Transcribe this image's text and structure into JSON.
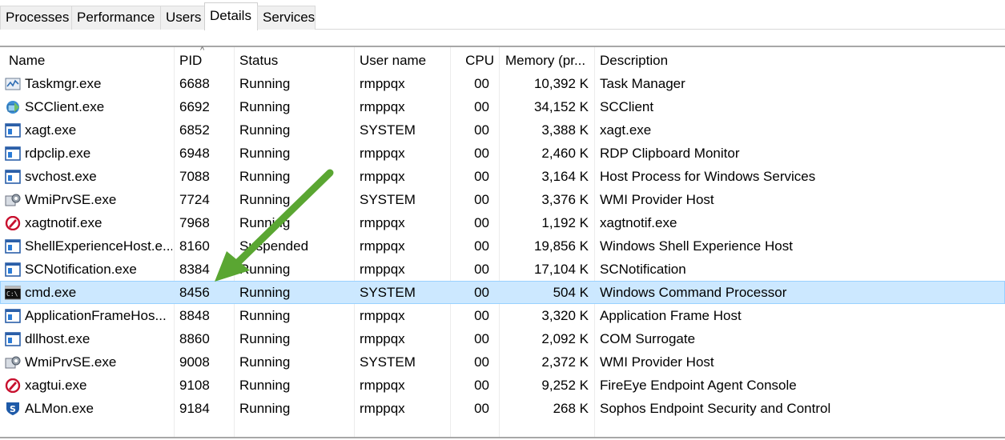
{
  "tabs": [
    {
      "label": "Processes",
      "active": false
    },
    {
      "label": "Performance",
      "active": false
    },
    {
      "label": "Users",
      "active": false
    },
    {
      "label": "Details",
      "active": true
    },
    {
      "label": "Services",
      "active": false
    }
  ],
  "columns": {
    "name": "Name",
    "pid": "PID",
    "status": "Status",
    "user": "User name",
    "cpu": "CPU",
    "memory": "Memory (pr...",
    "description": "Description"
  },
  "rows": [
    {
      "icon": "task-manager-icon",
      "name": "Taskmgr.exe",
      "pid": "6688",
      "status": "Running",
      "user": "rmppqx",
      "cpu": "00",
      "memory": "10,392 K",
      "description": "Task Manager",
      "selected": false
    },
    {
      "icon": "scclient-icon",
      "name": "SCClient.exe",
      "pid": "6692",
      "status": "Running",
      "user": "rmppqx",
      "cpu": "00",
      "memory": "34,152 K",
      "description": "SCClient",
      "selected": false
    },
    {
      "icon": "window-app-icon",
      "name": "xagt.exe",
      "pid": "6852",
      "status": "Running",
      "user": "SYSTEM",
      "cpu": "00",
      "memory": "3,388 K",
      "description": "xagt.exe",
      "selected": false
    },
    {
      "icon": "window-app-icon",
      "name": "rdpclip.exe",
      "pid": "6948",
      "status": "Running",
      "user": "rmppqx",
      "cpu": "00",
      "memory": "2,460 K",
      "description": "RDP Clipboard Monitor",
      "selected": false
    },
    {
      "icon": "window-app-icon",
      "name": "svchost.exe",
      "pid": "7088",
      "status": "Running",
      "user": "rmppqx",
      "cpu": "00",
      "memory": "3,164 K",
      "description": "Host Process for Windows Services",
      "selected": false
    },
    {
      "icon": "wmi-provider-icon",
      "name": "WmiPrvSE.exe",
      "pid": "7724",
      "status": "Running",
      "user": "SYSTEM",
      "cpu": "00",
      "memory": "3,376 K",
      "description": "WMI Provider Host",
      "selected": false
    },
    {
      "icon": "fireeye-icon",
      "name": "xagtnotif.exe",
      "pid": "7968",
      "status": "Running",
      "user": "rmppqx",
      "cpu": "00",
      "memory": "1,192 K",
      "description": "xagtnotif.exe",
      "selected": false
    },
    {
      "icon": "window-app-icon",
      "name": "ShellExperienceHost.e...",
      "pid": "8160",
      "status": "Suspended",
      "user": "rmppqx",
      "cpu": "00",
      "memory": "19,856 K",
      "description": "Windows Shell Experience Host",
      "selected": false
    },
    {
      "icon": "window-app-icon",
      "name": "SCNotification.exe",
      "pid": "8384",
      "status": "Running",
      "user": "rmppqx",
      "cpu": "00",
      "memory": "17,104 K",
      "description": "SCNotification",
      "selected": false
    },
    {
      "icon": "command-prompt-icon",
      "name": "cmd.exe",
      "pid": "8456",
      "status": "Running",
      "user": "SYSTEM",
      "cpu": "00",
      "memory": "504 K",
      "description": "Windows Command Processor",
      "selected": true
    },
    {
      "icon": "window-app-icon",
      "name": "ApplicationFrameHos...",
      "pid": "8848",
      "status": "Running",
      "user": "rmppqx",
      "cpu": "00",
      "memory": "3,320 K",
      "description": "Application Frame Host",
      "selected": false
    },
    {
      "icon": "window-app-icon",
      "name": "dllhost.exe",
      "pid": "8860",
      "status": "Running",
      "user": "rmppqx",
      "cpu": "00",
      "memory": "2,092 K",
      "description": "COM Surrogate",
      "selected": false
    },
    {
      "icon": "wmi-provider-icon",
      "name": "WmiPrvSE.exe",
      "pid": "9008",
      "status": "Running",
      "user": "SYSTEM",
      "cpu": "00",
      "memory": "2,372 K",
      "description": "WMI Provider Host",
      "selected": false
    },
    {
      "icon": "fireeye-icon",
      "name": "xagtui.exe",
      "pid": "9108",
      "status": "Running",
      "user": "rmppqx",
      "cpu": "00",
      "memory": "9,252 K",
      "description": "FireEye Endpoint Agent Console",
      "selected": false
    },
    {
      "icon": "sophos-icon",
      "name": "ALMon.exe",
      "pid": "9184",
      "status": "Running",
      "user": "rmppqx",
      "cpu": "00",
      "memory": "268 K",
      "description": "Sophos Endpoint Security and Control",
      "selected": false
    }
  ],
  "annotation": {
    "type": "green-arrow",
    "color": "#5aa632",
    "points_to": "cmd.exe"
  },
  "colors": {
    "selection": "#cce8ff",
    "selection_border": "#99d1ff",
    "arrow": "#5aa632"
  }
}
